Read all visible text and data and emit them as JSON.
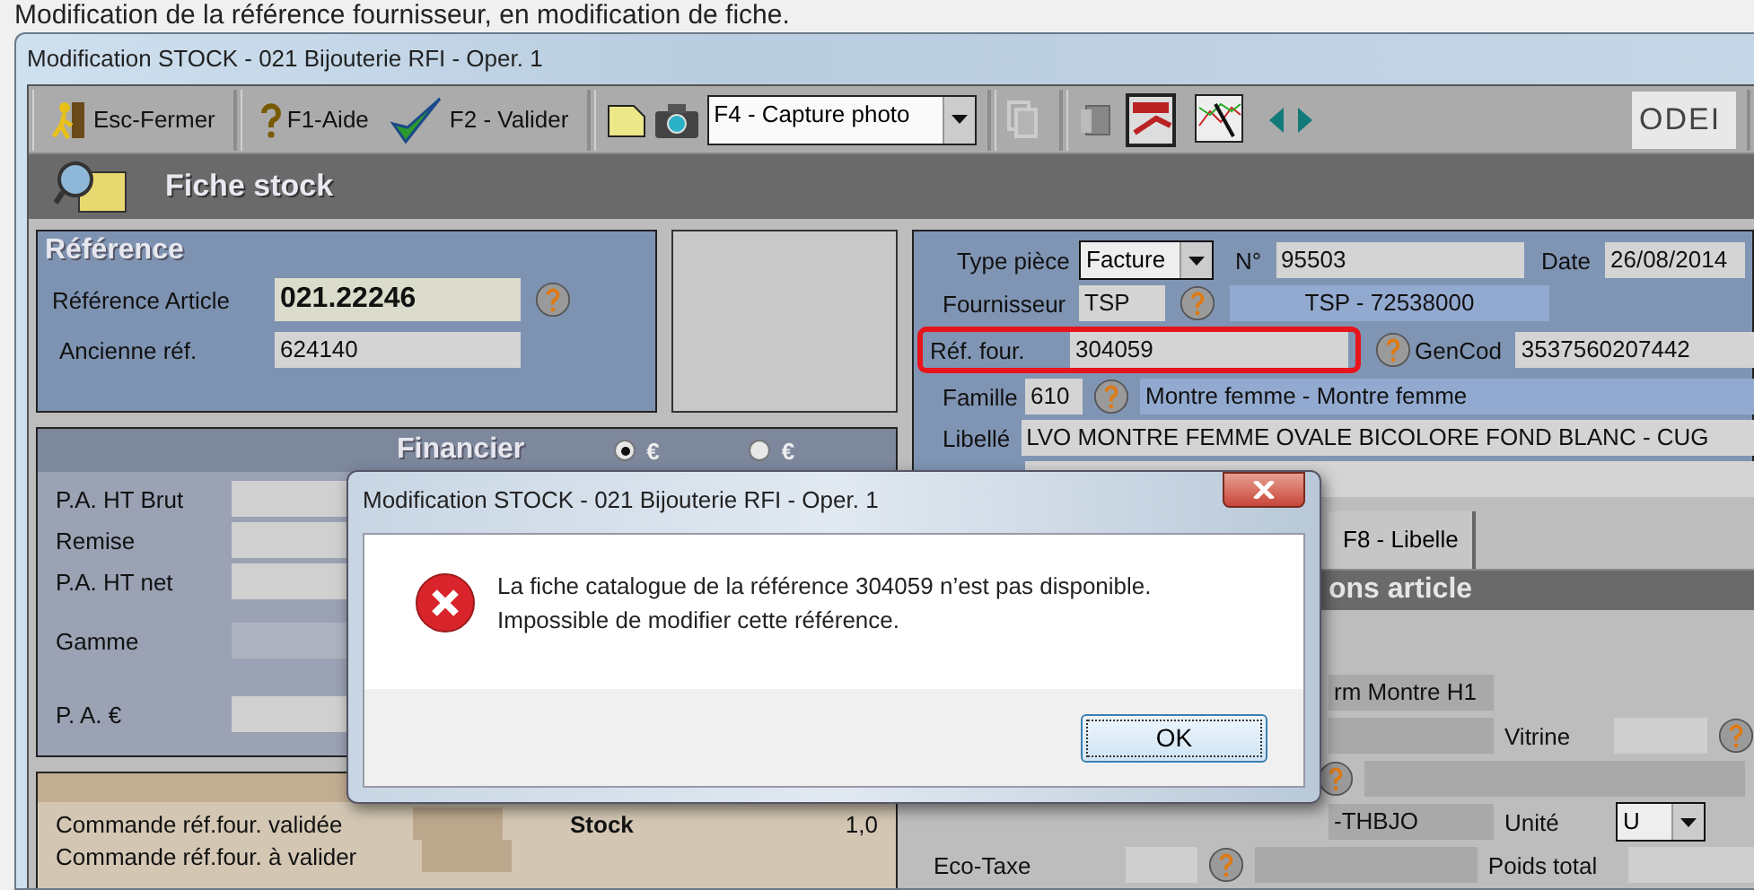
{
  "caption": "Modification de la référence fournisseur, en modification de fiche.",
  "window": {
    "title": "Modification STOCK - 021 Bijouterie RFI - Oper. 1"
  },
  "toolbar": {
    "buttons": [
      {
        "label": "Esc-Fermer",
        "kind": "exit"
      },
      {
        "label": "F1-Aide",
        "kind": "help"
      },
      {
        "label": "F2 - Valider",
        "kind": "check"
      }
    ],
    "capture": "F4 - Capture photo",
    "logo": "ODEI"
  },
  "header": {
    "title": "Fiche stock"
  },
  "reference": {
    "title": "Référence",
    "fields": [
      {
        "label": "Référence Article",
        "value": "021.22246",
        "kind": "key"
      },
      {
        "label": "Ancienne réf.",
        "value": "624140",
        "kind": "plain"
      }
    ]
  },
  "financier": {
    "title": "Financier",
    "currencies": [
      {
        "label": "€",
        "selected": true
      },
      {
        "label": "€",
        "selected": false
      }
    ],
    "rows": [
      {
        "label": "P.A. HT Brut"
      },
      {
        "label": "Remise"
      },
      {
        "label": "P.A. HT net"
      },
      {
        "label": "Gamme"
      },
      {
        "label": "P. A. €"
      }
    ]
  },
  "stock": {
    "rows": [
      {
        "label": "Commande réf.four. validée"
      },
      {
        "label": "Commande réf.four. à valider"
      }
    ],
    "stock_label": "Stock",
    "stock_value": "1,0"
  },
  "document": {
    "type_label": "Type pièce",
    "type": "Facture",
    "number_label": "N°",
    "number": "95503",
    "date_label": "Date",
    "date": "26/08/2014",
    "supplier_label": "Fournisseur",
    "supplier_code": "TSP",
    "supplier_name": "TSP - 72538000",
    "ref_label": "Réf. four.",
    "ref": "304059",
    "ref_highlighted": true,
    "gencod_label": "GenCod",
    "gencod": "3537560207442",
    "family_label": "Famille",
    "family_code": "610",
    "family_name": "Montre femme - Montre femme",
    "libelle_label": "Libellé",
    "libelle": "LVO MONTRE FEMME OVALE BICOLORE FOND BLANC - CUG"
  },
  "tab": "F8 - Libelle",
  "options": {
    "title": "ons article",
    "form_value": "rm Montre H1",
    "vitrine_label": "Vitrine",
    "code_value": "-THBJO",
    "unit_label": "Unité",
    "unit": "U",
    "ecotax_label": "Eco-Taxe",
    "weight_label": "Poids total"
  },
  "dialog": {
    "title": "Modification STOCK - 021 Bijouterie RFI - Oper. 1",
    "message": [
      "La fiche catalogue de la référence 304059 n’est pas disponible.",
      "Impossible de modifier cette référence."
    ],
    "button": "OK"
  }
}
